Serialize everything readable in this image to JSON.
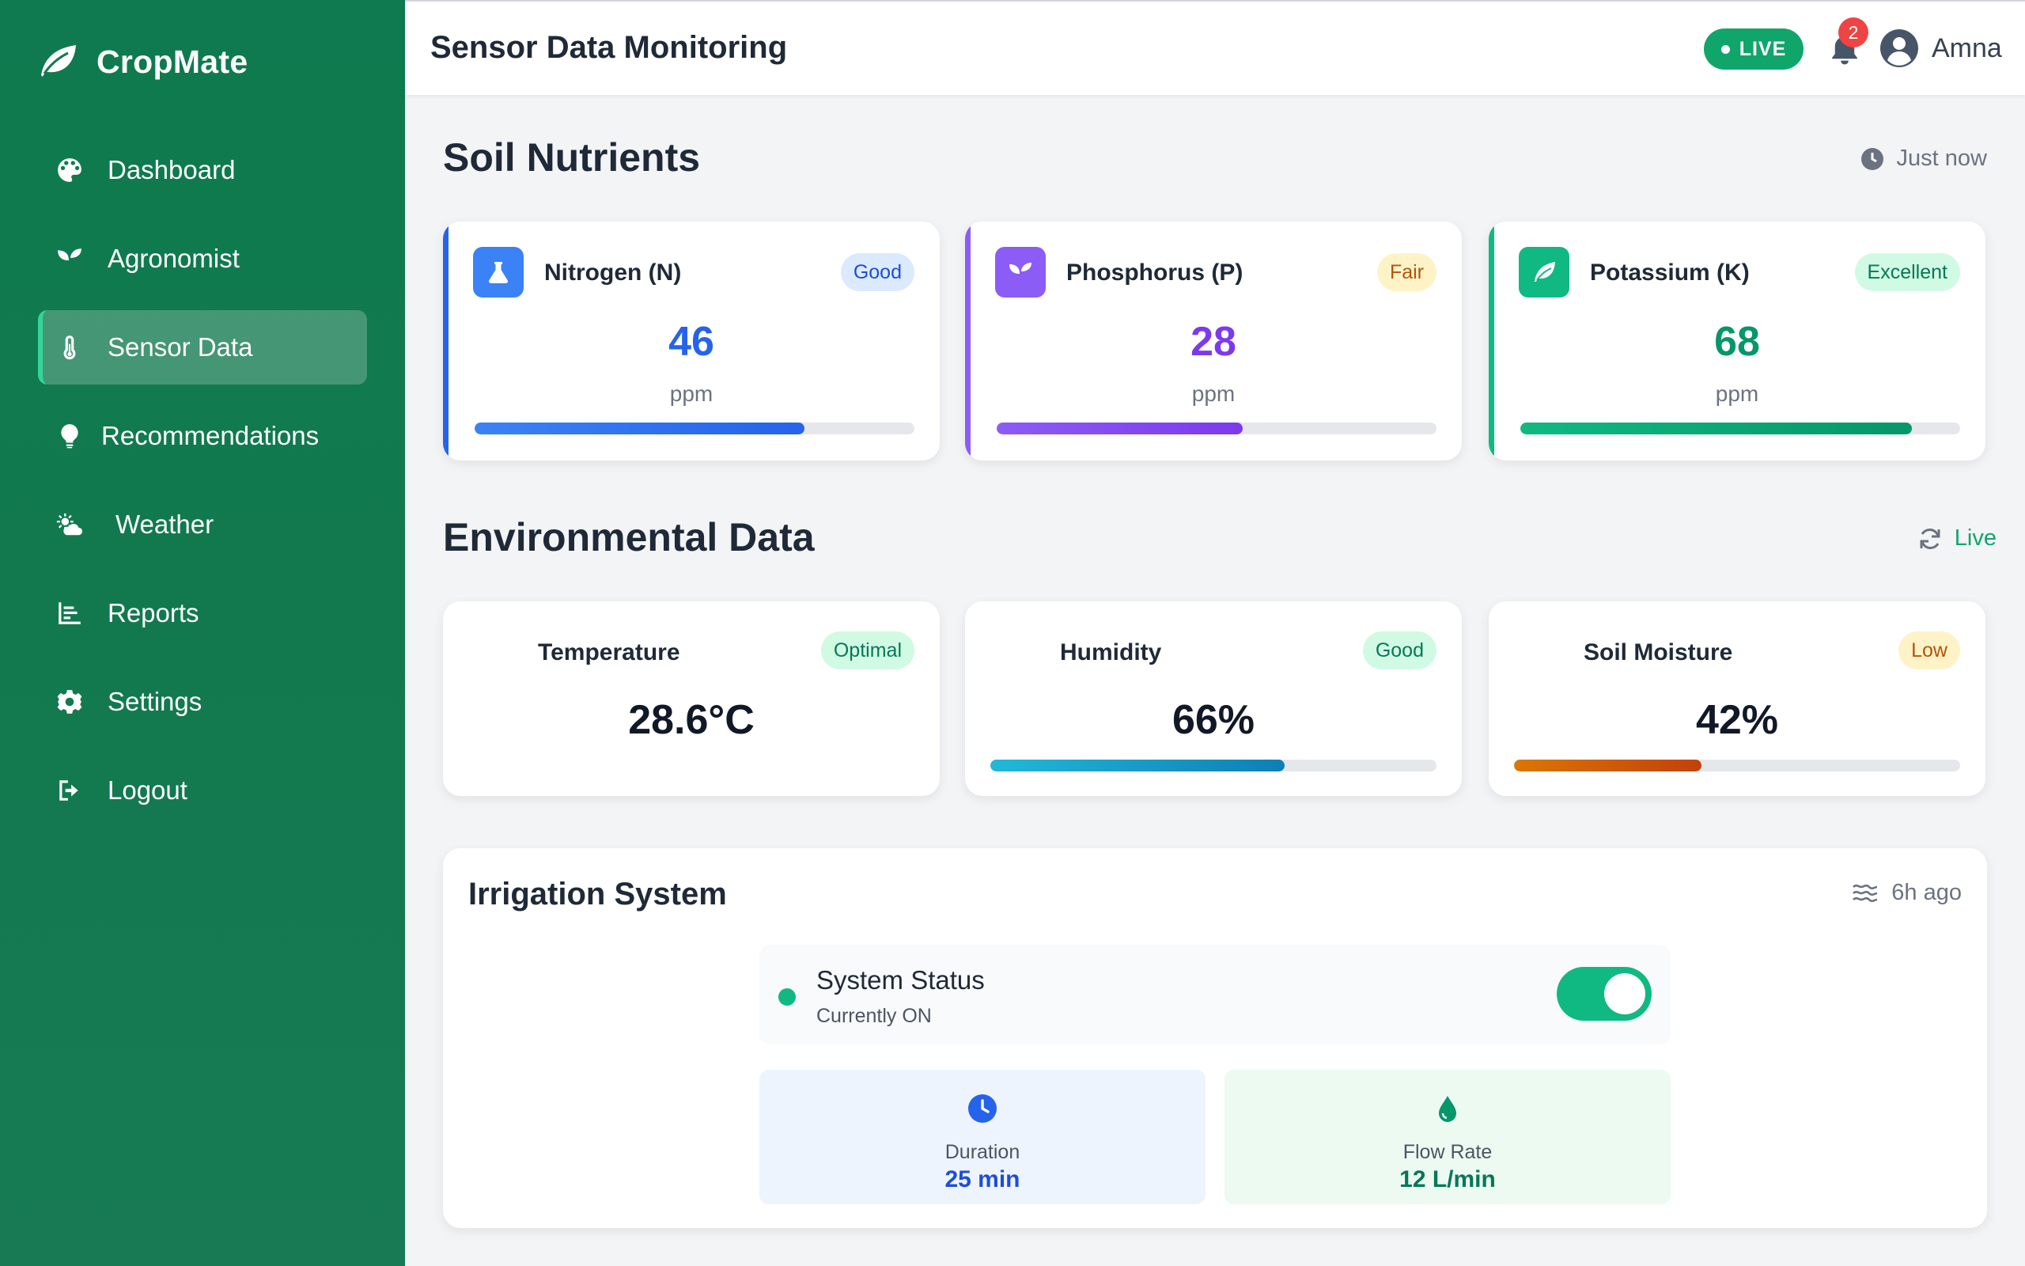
{
  "app": {
    "name": "CropMate",
    "logo_icon": "leaf-icon"
  },
  "sidebar": {
    "items": [
      {
        "label": "Dashboard",
        "icon": "palette-icon"
      },
      {
        "label": "Agronomist",
        "icon": "seedling-icon"
      },
      {
        "label": "Sensor Data",
        "icon": "thermometer-icon",
        "active": true
      },
      {
        "label": "Recommendations",
        "icon": "lightbulb-icon"
      },
      {
        "label": "Weather",
        "icon": "sun-cloud-icon"
      },
      {
        "label": "Reports",
        "icon": "chart-icon"
      },
      {
        "label": "Settings",
        "icon": "gear-icon"
      },
      {
        "label": "Logout",
        "icon": "logout-icon"
      }
    ]
  },
  "header": {
    "title": "Sensor Data Monitoring",
    "live_label": "LIVE",
    "notification_count": "2",
    "user_name": "Amna"
  },
  "soil": {
    "title": "Soil Nutrients",
    "updated": "Just now",
    "cards": [
      {
        "name": "Nitrogen (N)",
        "status": "Good",
        "value": "46",
        "unit": "ppm",
        "level_pct": 75,
        "color": "#2563eb",
        "icon": "flask-icon"
      },
      {
        "name": "Phosphorus (P)",
        "status": "Fair",
        "value": "28",
        "unit": "ppm",
        "level_pct": 56,
        "color": "#7c3aed",
        "icon": "seedling-icon"
      },
      {
        "name": "Potassium (K)",
        "status": "Excellent",
        "value": "68",
        "unit": "ppm",
        "level_pct": 89,
        "color": "#059669",
        "icon": "leaf-icon"
      }
    ]
  },
  "environment": {
    "title": "Environmental Data",
    "live_label": "Live",
    "cards": [
      {
        "name": "Temperature",
        "status": "Optimal",
        "value": "28.6°C"
      },
      {
        "name": "Humidity",
        "status": "Good",
        "value": "66%",
        "level_pct": 66,
        "color": "#0891b2"
      },
      {
        "name": "Soil Moisture",
        "status": "Low",
        "value": "42%",
        "level_pct": 42,
        "color": "#c2410c"
      }
    ]
  },
  "irrigation": {
    "title": "Irrigation System",
    "updated": "6h ago",
    "status_title": "System Status",
    "status_sub": "Currently ON",
    "toggle_on": true,
    "duration_label": "Duration",
    "duration_value": "25 min",
    "flow_label": "Flow Rate",
    "flow_value": "12 L/min"
  },
  "colors": {
    "sidebar_green": "#13794f",
    "accent_green": "#10b981",
    "good_badge_bg": "#dbeafe",
    "fair_badge_bg": "#fef3c7",
    "excellent_badge_bg": "#d1fae5"
  }
}
